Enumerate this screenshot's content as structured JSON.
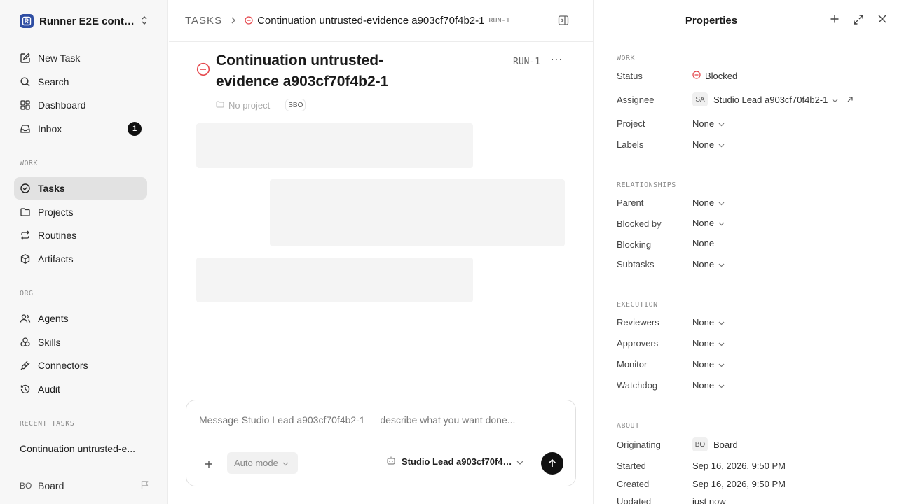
{
  "workspace": {
    "name": "Runner E2E conti..."
  },
  "sidebar": {
    "primary": [
      {
        "label": "New Task"
      },
      {
        "label": "Search"
      },
      {
        "label": "Dashboard"
      },
      {
        "label": "Inbox",
        "badge": "1"
      }
    ],
    "work_label": "WORK",
    "work": [
      {
        "label": "Tasks",
        "active": true
      },
      {
        "label": "Projects"
      },
      {
        "label": "Routines"
      },
      {
        "label": "Artifacts"
      }
    ],
    "org_label": "ORG",
    "org": [
      {
        "label": "Agents"
      },
      {
        "label": "Skills"
      },
      {
        "label": "Connectors"
      },
      {
        "label": "Audit"
      }
    ],
    "recent_label": "RECENT TASKS",
    "recent": [
      {
        "label": "Continuation untrusted-e..."
      }
    ],
    "user": {
      "initials": "BO",
      "name": "Board"
    }
  },
  "breadcrumb": {
    "root": "TASKS",
    "title": "Continuation untrusted-evidence a903cf70f4b2-1",
    "id": "RUN-1"
  },
  "task": {
    "title": "Continuation untrusted-evidence a903cf70f4b2-1",
    "id": "RUN-1",
    "more": "···",
    "project": "No project",
    "avatars": "S⁠BO"
  },
  "composer": {
    "placeholder": "Message Studio Lead a903cf70f4b2-1 — describe what you want done...",
    "mode": "Auto mode",
    "agent": "Studio Lead a903cf70f4b..."
  },
  "properties": {
    "title": "Properties",
    "work_label": "WORK",
    "status_label": "Status",
    "status_value": "Blocked",
    "assignee_label": "Assignee",
    "assignee_initials": "SA",
    "assignee_value": "Studio Lead a903cf70f4b2-1",
    "project_label": "Project",
    "project_value": "None",
    "labels_label": "Labels",
    "labels_value": "None",
    "relationships_label": "RELATIONSHIPS",
    "parent_label": "Parent",
    "parent_value": "None",
    "blocked_by_label": "Blocked by",
    "blocked_by_value": "None",
    "blocking_label": "Blocking",
    "blocking_value": "None",
    "subtasks_label": "Subtasks",
    "subtasks_value": "None",
    "execution_label": "EXECUTION",
    "reviewers_label": "Reviewers",
    "reviewers_value": "None",
    "approvers_label": "Approvers",
    "approvers_value": "None",
    "monitor_label": "Monitor",
    "monitor_value": "None",
    "watchdog_label": "Watchdog",
    "watchdog_value": "None",
    "about_label": "ABOUT",
    "originating_label": "Originating",
    "originating_initials": "BO",
    "originating_value": "Board",
    "started_label": "Started",
    "started_value": "Sep 16, 2026, 9:50 PM",
    "created_label": "Created",
    "created_value": "Sep 16, 2026, 9:50 PM",
    "updated_label": "Updated",
    "updated_value": "just now"
  },
  "colors": {
    "blocked": "#e5484d",
    "active_nav": "#e2e2e2",
    "send": "#111111"
  }
}
